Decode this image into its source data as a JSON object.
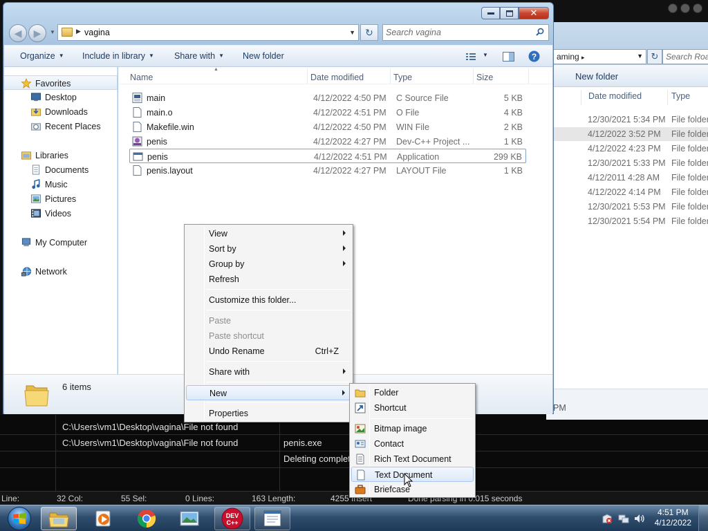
{
  "ide": {
    "output_lines": [
      "C:\\Users\\vm1\\Desktop\\vagina\\File not found",
      "C:\\Users\\vm1\\Desktop\\vagina\\File not found"
    ],
    "output_col2": [
      "penis.exe",
      "Deleting complet"
    ],
    "status": {
      "line": "Line:",
      "col": "32 Col:",
      "sel": "55 Sel:",
      "lines": "0 Lines:",
      "length": "163 Length:",
      "insert": "4255 Insert",
      "parsing": "Done parsing in 0.015 seconds"
    }
  },
  "bg_explorer": {
    "path": "aming",
    "search_placeholder": "Search Roa",
    "new_folder": "New folder",
    "col_date": "Date modified",
    "col_type": "Type",
    "rows": [
      {
        "date": "12/30/2021 5:34 PM",
        "type": "File folder"
      },
      {
        "date": "4/12/2022 3:52 PM",
        "type": "File folder"
      },
      {
        "date": "4/12/2022 4:23 PM",
        "type": "File folder"
      },
      {
        "date": "12/30/2021 5:33 PM",
        "type": "File folder"
      },
      {
        "date": "4/12/2011 4:28 AM",
        "type": "File folder"
      },
      {
        "date": "4/12/2022 4:14 PM",
        "type": "File folder"
      },
      {
        "date": "12/30/2021 5:53 PM",
        "type": "File folder"
      },
      {
        "date": "12/30/2021 5:54 PM",
        "type": "File folder"
      }
    ],
    "status_fragment": "PM"
  },
  "explorer": {
    "path": "vagina",
    "search_placeholder": "Search vagina",
    "toolbar": {
      "organize": "Organize",
      "include": "Include in library",
      "share": "Share with",
      "new_folder": "New folder"
    },
    "nav": {
      "favorites": "Favorites",
      "desktop": "Desktop",
      "downloads": "Downloads",
      "recent": "Recent Places",
      "libraries": "Libraries",
      "documents": "Documents",
      "music": "Music",
      "pictures": "Pictures",
      "videos": "Videos",
      "computer": "My Computer",
      "network": "Network"
    },
    "columns": {
      "name": "Name",
      "date": "Date modified",
      "type": "Type",
      "size": "Size"
    },
    "files": [
      {
        "name": "main",
        "date": "4/12/2022 4:50 PM",
        "type": "C Source File",
        "size": "5 KB",
        "icon": "c-source-icon"
      },
      {
        "name": "main.o",
        "date": "4/12/2022 4:51 PM",
        "type": "O File",
        "size": "4 KB",
        "icon": "file-icon"
      },
      {
        "name": "Makefile.win",
        "date": "4/12/2022 4:50 PM",
        "type": "WIN File",
        "size": "2 KB",
        "icon": "file-icon"
      },
      {
        "name": "penis",
        "date": "4/12/2022 4:27 PM",
        "type": "Dev-C++ Project ...",
        "size": "1 KB",
        "icon": "devcpp-project-icon"
      },
      {
        "name": "penis",
        "date": "4/12/2022 4:51 PM",
        "type": "Application",
        "size": "299 KB",
        "icon": "application-icon"
      },
      {
        "name": "penis.layout",
        "date": "4/12/2022 4:27 PM",
        "type": "LAYOUT File",
        "size": "1 KB",
        "icon": "file-icon"
      }
    ],
    "status": "6 items"
  },
  "context_menu": {
    "view": "View",
    "sort_by": "Sort by",
    "group_by": "Group by",
    "refresh": "Refresh",
    "customize": "Customize this folder...",
    "paste": "Paste",
    "paste_shortcut": "Paste shortcut",
    "undo": "Undo Rename",
    "undo_shortcut": "Ctrl+Z",
    "share": "Share with",
    "new": "New",
    "properties": "Properties"
  },
  "new_submenu": {
    "folder": "Folder",
    "shortcut": "Shortcut",
    "bitmap": "Bitmap image",
    "contact": "Contact",
    "rtf": "Rich Text Document",
    "text": "Text Document",
    "briefcase": "Briefcase"
  },
  "taskbar": {
    "time": "4:51 PM",
    "date": "4/12/2022",
    "devcpp_label": "DEV C++"
  }
}
